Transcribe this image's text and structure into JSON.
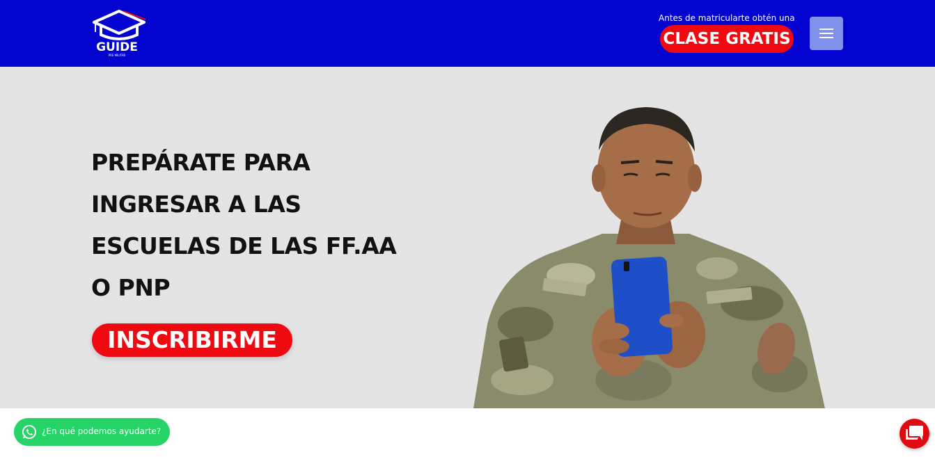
{
  "header": {
    "logo": {
      "word": "GUIDE",
      "sub": "PRE MILITAR"
    },
    "promo": {
      "caption": "Antes de matricularte obtén una",
      "button_label": "CLASE GRATIS"
    },
    "menu_icon": "hamburger-icon"
  },
  "hero": {
    "title": "PREPÁRATE PARA INGRESAR A LAS ESCUELAS DE LAS FF.AA O PNP",
    "cta_label": "INSCRIBIRME",
    "photo": "soldier-with-phone"
  },
  "widgets": {
    "whatsapp": {
      "icon": "whatsapp-icon",
      "label": "¿En qué podemos ayudarte?"
    },
    "chat_icon": "chat-icon"
  },
  "colors": {
    "header_bg": "#0303cf",
    "accent_red": "#ee0a10",
    "hero_bg": "#e4e4e4",
    "menu_button": "#7f91eb",
    "whatsapp_green": "#25d366"
  }
}
